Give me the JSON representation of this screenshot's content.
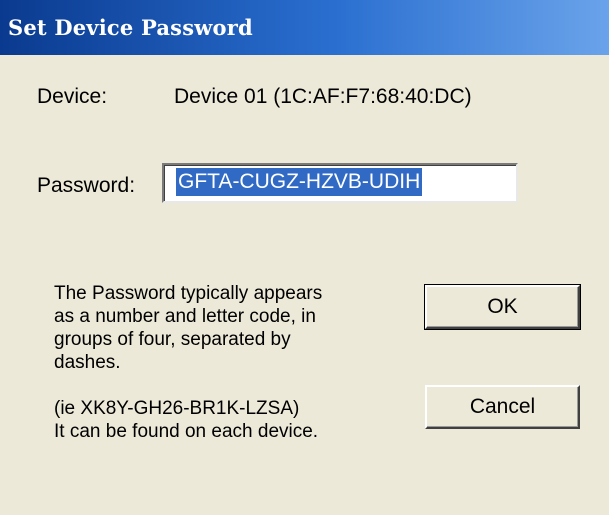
{
  "window": {
    "title": "Set Device Password"
  },
  "device": {
    "label": "Device:",
    "value": "Device 01  (1C:AF:F7:68:40:DC)"
  },
  "password": {
    "label": "Password:",
    "value": "GFTA-CUGZ-HZVB-UDIH"
  },
  "help": {
    "lines": [
      "The Password typically appears",
      "as a number and letter code, in",
      "groups of four, separated by",
      "dashes.",
      "",
      "(ie XK8Y-GH26-BR1K-LZSA)",
      "It can be found on each device."
    ]
  },
  "buttons": {
    "ok_label": "OK",
    "cancel_label": "Cancel"
  },
  "colors": {
    "titlebar_dark": "#0a3a8f",
    "titlebar_light": "#6aa3ea",
    "dialog_background": "#ece9d8",
    "selection": "#316ac5"
  }
}
